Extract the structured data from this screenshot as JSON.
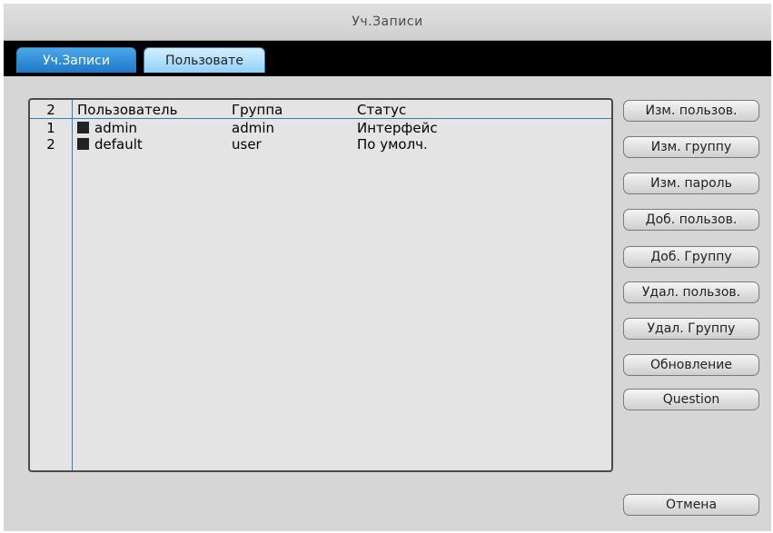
{
  "window": {
    "title": "Уч.Записи"
  },
  "tabs": [
    {
      "label": "Уч.Записи",
      "active": true
    },
    {
      "label": "Пользовате",
      "active": false
    }
  ],
  "user_list": {
    "count": "2",
    "headers": {
      "user": "Пользователь",
      "group": "Группа",
      "status": "Статус"
    },
    "rows": [
      {
        "num": "1",
        "user": "admin",
        "group": "admin",
        "status": "Интерфейс"
      },
      {
        "num": "2",
        "user": "default",
        "group": "user",
        "status": "По умолч."
      }
    ]
  },
  "buttons": {
    "edit_user": "Изм. пользов.",
    "edit_group": "Изм. группу",
    "edit_password": "Изм. пароль",
    "add_user": "Доб. пользов.",
    "add_group": "Доб. Группу",
    "delete_user": "Удал. пользов.",
    "delete_group": "Удал. Группу",
    "refresh": "Обновление",
    "question": "Question",
    "cancel": "Отмена"
  },
  "colors": {
    "tab_accent": "#1e78c8",
    "divider_line": "#2f7fc0",
    "frame_background": "#000000",
    "panel_background": "#d6d6d6"
  }
}
